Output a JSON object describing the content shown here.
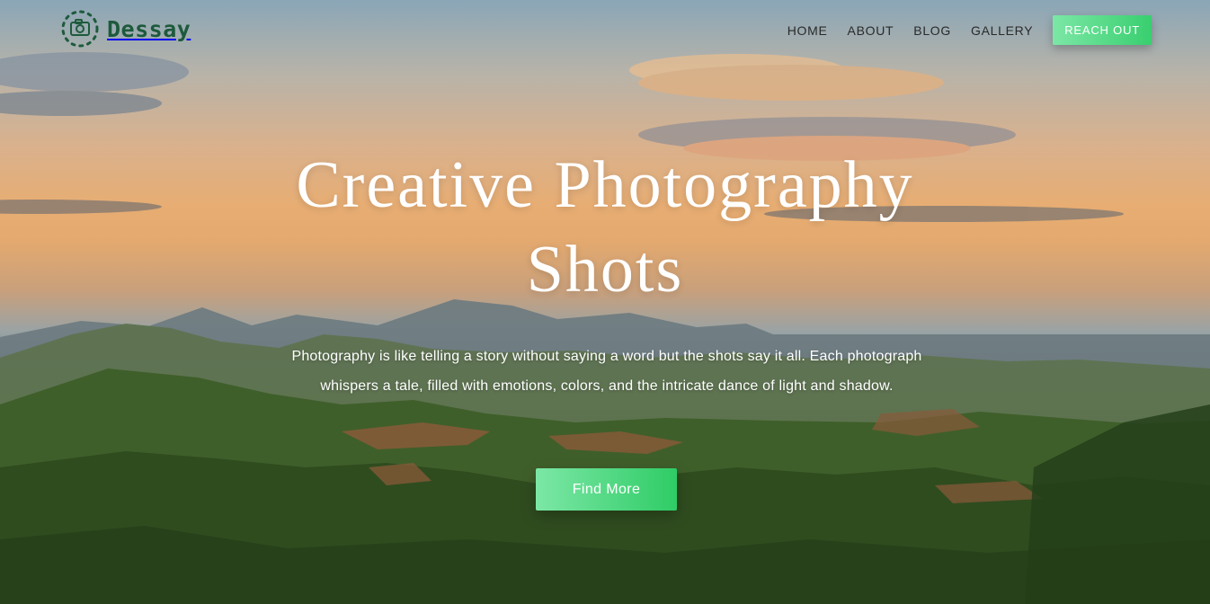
{
  "brand": {
    "name": "Dessay",
    "logo_icon": "camera-icon",
    "accent_color": "#1d5a3c"
  },
  "nav": {
    "items": [
      "HOME",
      "ABOUT",
      "BLOG",
      "GALLERY"
    ],
    "cta_label": "REACH OUT"
  },
  "hero": {
    "title_line_1": "Creative Photography",
    "title_line_2": "Shots",
    "description": "Photography is like telling a story without saying a word but the shots say it all. Each photograph whispers a tale, filled with emotions, colors, and the intricate dance of light and shadow.",
    "button_label": "Find More"
  },
  "colors": {
    "button_gradient_start": "#7ce7a6",
    "button_gradient_end": "#2fcc66"
  }
}
